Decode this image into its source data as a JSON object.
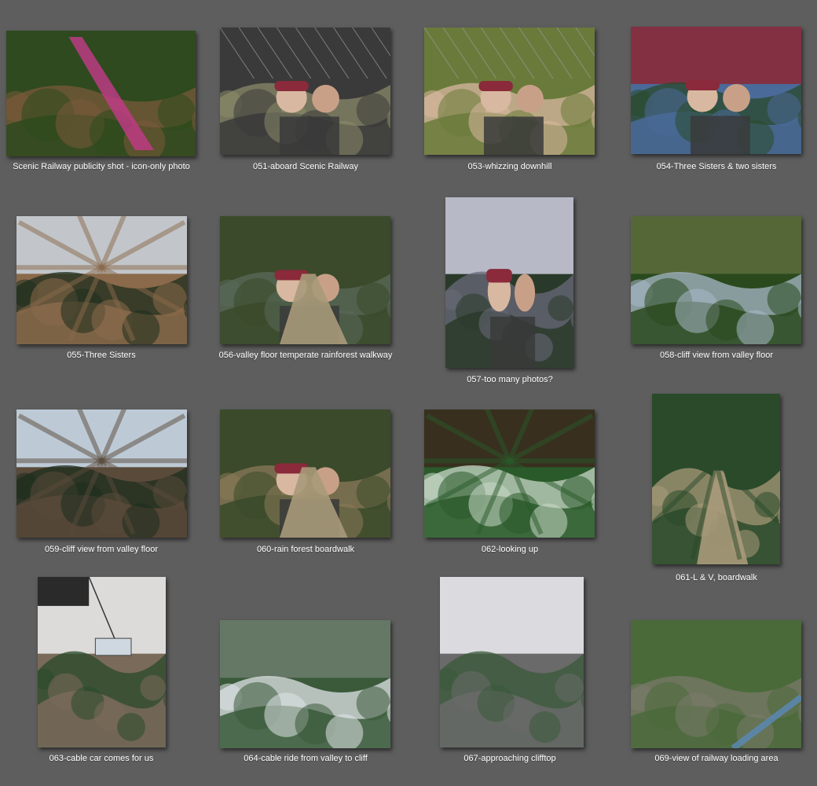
{
  "window": {
    "background": "#5e5e5e"
  },
  "photos": [
    {
      "caption": "Scenic Railway publicity shot - icon-only photo",
      "scene": "railway-incline-in-forest",
      "palette": [
        "#2e4a1e",
        "#7a5a3a",
        "#c43a8a"
      ]
    },
    {
      "caption": "051-aboard Scenic Railway",
      "scene": "people-under-cage-roof",
      "palette": [
        "#3a3a3a",
        "#8a8a6a",
        "#c06a7a"
      ]
    },
    {
      "caption": "053-whizzing downhill",
      "scene": "selfie-two-people-cage",
      "palette": [
        "#6a7a3a",
        "#d8b8a0",
        "#8a2a3a"
      ]
    },
    {
      "caption": "054-Three Sisters & two sisters",
      "scene": "selfie-cliff-background",
      "palette": [
        "#4a6a9a",
        "#2a4a2a",
        "#8a2a3a"
      ]
    },
    {
      "caption": "055-Three Sisters",
      "scene": "rock-formation-ferns",
      "palette": [
        "#8a6a4a",
        "#1e2e1e",
        "#c8d0d8"
      ]
    },
    {
      "caption": "056-valley floor temperate rainforest walkway",
      "scene": "walkway-rainforest",
      "palette": [
        "#3a4a2a",
        "#5a6a5a",
        "#8a8a8a"
      ]
    },
    {
      "caption": "057-too many photos?",
      "scene": "two-people-forest-cliff",
      "palette": [
        "#2a3a2a",
        "#6a6a7a",
        "#c8c8d8"
      ]
    },
    {
      "caption": "058-cliff view from valley floor",
      "scene": "cliff-through-trees",
      "palette": [
        "#2a4a1e",
        "#a8b8c8",
        "#5a6a3a"
      ]
    },
    {
      "caption": "059-cliff view from valley floor",
      "scene": "cliff-fern-frame",
      "palette": [
        "#5a4a3a",
        "#1e2e1e",
        "#c8d8e8"
      ]
    },
    {
      "caption": "060-rain forest boardwalk",
      "scene": "boardwalk-with-people",
      "palette": [
        "#3a4a2a",
        "#8a7a5a",
        "#6a7a5a"
      ]
    },
    {
      "caption": "062-looking up",
      "scene": "tree-ferns-looking-up",
      "palette": [
        "#2a5a2a",
        "#c8d8c8",
        "#3a2a1e"
      ]
    },
    {
      "caption": "061-L & V, boardwalk",
      "scene": "long-boardwalk-tree-fern",
      "palette": [
        "#2a4a2a",
        "#a89a7a",
        "#d8e8d8"
      ]
    },
    {
      "caption": "063-cable car comes for us",
      "scene": "cable-car-cliff",
      "palette": [
        "#7a6a5a",
        "#2a4a2a",
        "#e8e8e8"
      ]
    },
    {
      "caption": "064-cable ride from valley to cliff",
      "scene": "valley-treetops-sky",
      "palette": [
        "#3a5a3a",
        "#e0e4e8",
        "#6a7a6a"
      ]
    },
    {
      "caption": "067-approaching clifftop",
      "scene": "cliff-face-forest",
      "palette": [
        "#6a6a6a",
        "#3a5a3a",
        "#e8e8ec"
      ]
    },
    {
      "caption": "069-view of railway loading area",
      "scene": "forest-slope-railway",
      "palette": [
        "#4a6a3a",
        "#7a7a6a",
        "#5a8ab8"
      ]
    }
  ]
}
